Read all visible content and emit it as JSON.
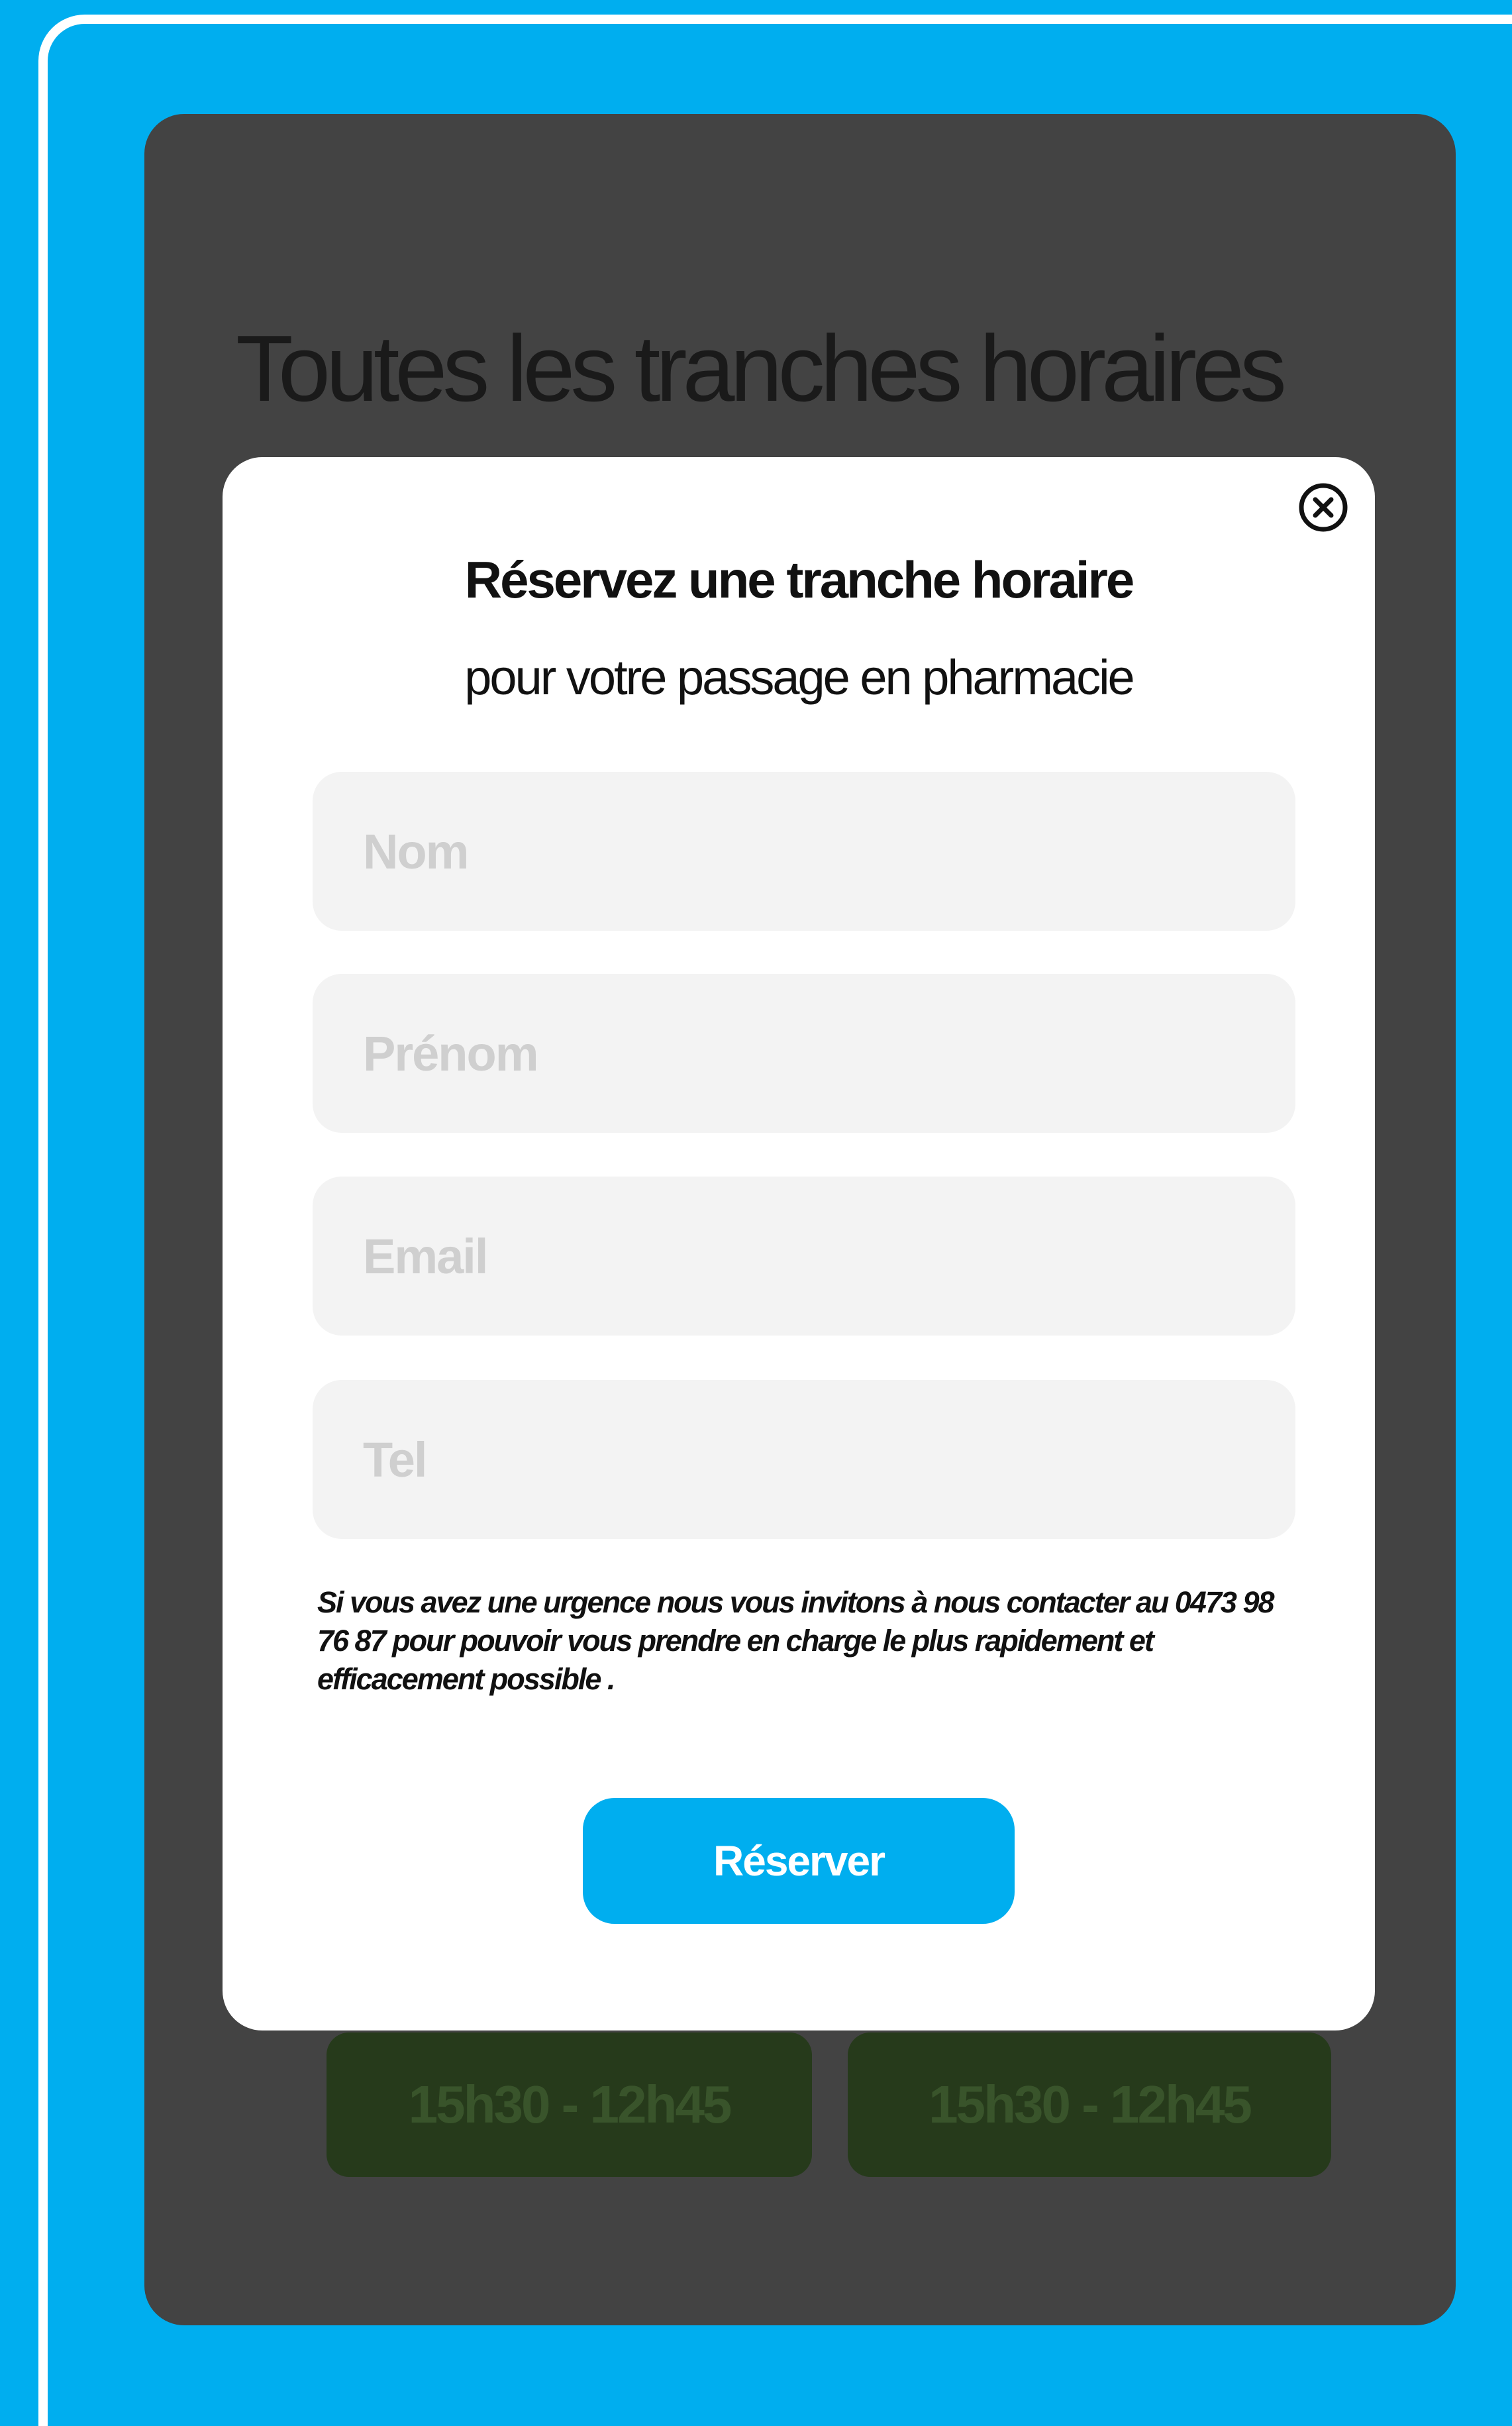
{
  "background": {
    "heading": "Toutes les tranches horaires disponibles",
    "slots": [
      {
        "label": "15h30 - 12h45"
      },
      {
        "label": "15h30 - 12h45"
      }
    ]
  },
  "modal": {
    "close_icon": "close-circle-icon",
    "title": "Réservez une tranche horaire",
    "subtitle": "pour votre passage en pharmacie",
    "fields": {
      "nom": {
        "placeholder": "Nom",
        "value": ""
      },
      "prenom": {
        "placeholder": "Prénom",
        "value": ""
      },
      "email": {
        "placeholder": "Email",
        "value": ""
      },
      "tel": {
        "placeholder": "Tel",
        "value": ""
      }
    },
    "notice": "Si vous avez une urgence nous vous invitons à nous contacter au 0473 98 76 87 pour pouvoir vous prendre en charge le plus rapidement et efficacement possible .",
    "submit_label": "Réserver"
  },
  "colors": {
    "accent": "#00aeef",
    "backdrop": "#434343",
    "slot": "#263a1b",
    "field": "#f3f3f3"
  }
}
